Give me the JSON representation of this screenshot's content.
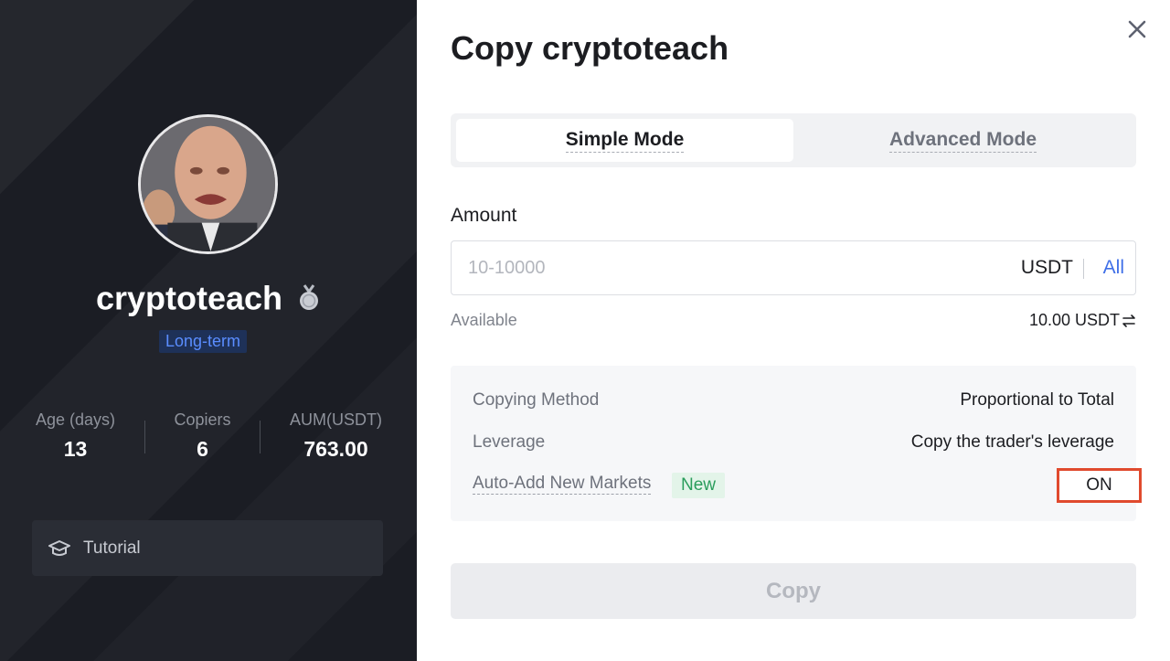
{
  "trader": {
    "name": "cryptoteach",
    "tag": "Long-term",
    "stats": [
      {
        "label": "Age (days)",
        "value": "13"
      },
      {
        "label": "Copiers",
        "value": "6"
      },
      {
        "label": "AUM(USDT)",
        "value": "763.00"
      }
    ],
    "tutorial_label": "Tutorial"
  },
  "dialog": {
    "title": "Copy cryptoteach",
    "tabs": {
      "simple": "Simple Mode",
      "advanced": "Advanced Mode"
    },
    "amount": {
      "label": "Amount",
      "placeholder": "10-10000",
      "unit": "USDT",
      "all_label": "All"
    },
    "available": {
      "label": "Available",
      "value": "10.00 USDT"
    },
    "settings": {
      "copying_method_label": "Copying Method",
      "copying_method_value": "Proportional to Total",
      "leverage_label": "Leverage",
      "leverage_value": "Copy the trader's leverage",
      "auto_add_label": "Auto-Add New Markets",
      "new_badge": "New",
      "toggle_value": "ON"
    },
    "copy_button": "Copy"
  },
  "colors": {
    "left_bg": "#1b1d24",
    "accent_blue": "#3f6fe8",
    "badge_green": "#2a9d5c",
    "highlight_red": "#e04a2e"
  }
}
